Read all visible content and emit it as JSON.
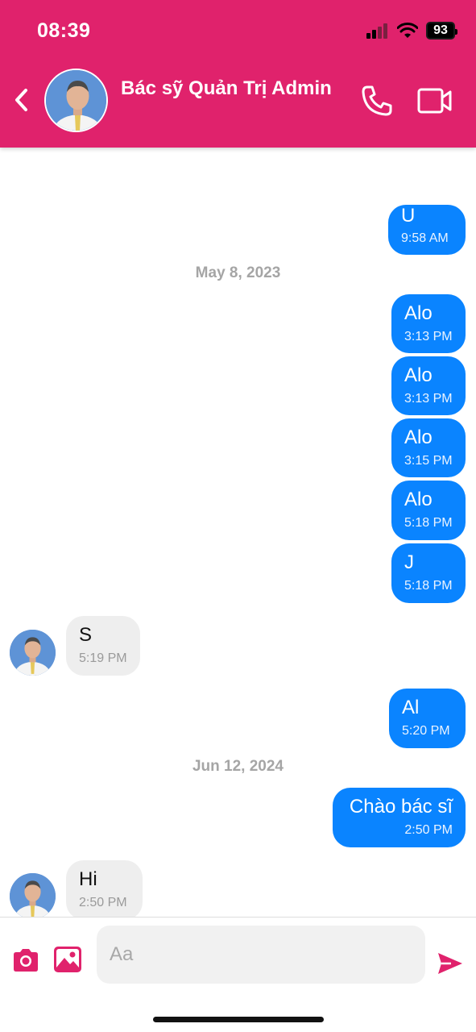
{
  "status_bar": {
    "time": "08:39",
    "battery": "93"
  },
  "header": {
    "contact_name": "Bác sỹ Quản Trị Admin"
  },
  "messages": [
    {
      "type": "out",
      "text": "U",
      "time": "9:58 AM"
    },
    {
      "type": "date",
      "text": "May 8, 2023"
    },
    {
      "type": "out",
      "text": "Alo",
      "time": "3:13 PM"
    },
    {
      "type": "out",
      "text": "Alo",
      "time": "3:13 PM"
    },
    {
      "type": "out",
      "text": "Alo",
      "time": "3:15 PM"
    },
    {
      "type": "out",
      "text": "Alo",
      "time": "5:18 PM"
    },
    {
      "type": "out",
      "text": "J",
      "time": "5:18 PM"
    },
    {
      "type": "in",
      "text": "S",
      "time": "5:19 PM"
    },
    {
      "type": "out",
      "text": "Al",
      "time": "5:20 PM"
    },
    {
      "type": "date",
      "text": "Jun 12, 2024"
    },
    {
      "type": "out",
      "text": "Chào bác sĩ",
      "time": "2:50 PM"
    },
    {
      "type": "in",
      "text": "Hi",
      "time": "2:50 PM"
    }
  ],
  "composer": {
    "placeholder": "Aa"
  },
  "colors": {
    "header": "#e0226c",
    "outgoing_bubble": "#0a84ff",
    "incoming_bubble": "#eeeeee",
    "accent": "#e0226c"
  },
  "icons": [
    "back-chevron-icon",
    "phone-icon",
    "video-camera-icon",
    "camera-icon",
    "image-icon",
    "send-icon"
  ]
}
